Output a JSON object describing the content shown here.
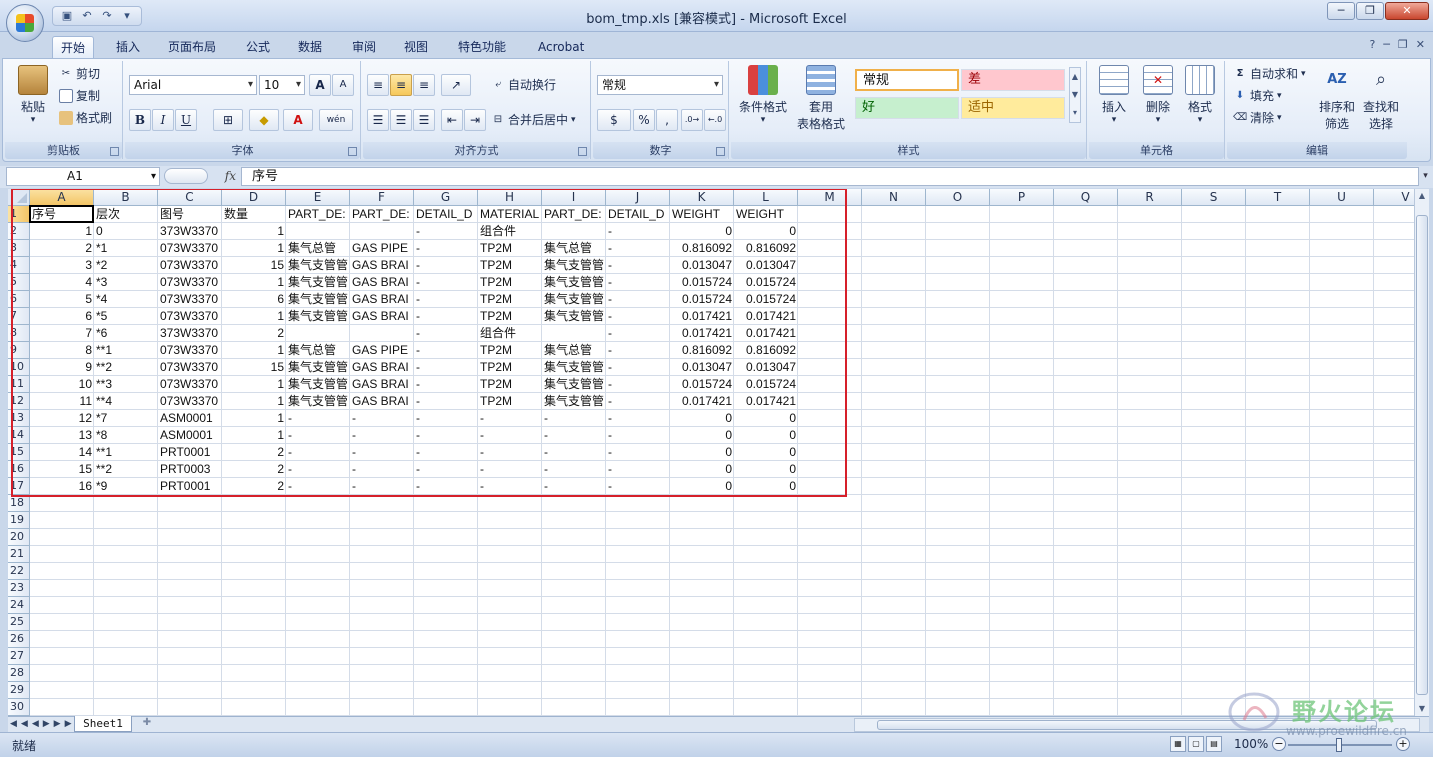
{
  "window": {
    "title": "bom_tmp.xls  [兼容模式] - Microsoft Excel"
  },
  "tabs": [
    "开始",
    "插入",
    "页面布局",
    "公式",
    "数据",
    "审阅",
    "视图",
    "特色功能",
    "Acrobat"
  ],
  "ribbon": {
    "clipboard": {
      "label": "剪贴板",
      "paste": "粘贴",
      "cut": "剪切",
      "copy": "复制",
      "painter": "格式刷"
    },
    "font": {
      "label": "字体",
      "name": "Arial",
      "size": "10",
      "bold": "B",
      "italic": "I",
      "underline": "U",
      "phonetic": "wén"
    },
    "alignment": {
      "label": "对齐方式",
      "wrap": "自动换行",
      "merge": "合并后居中"
    },
    "number": {
      "label": "数字",
      "format": "常规",
      "percent": "%",
      "comma": ","
    },
    "styles": {
      "label": "样式",
      "conditional": "条件格式",
      "table": "套用",
      "table2": "表格格式",
      "normal": "常规",
      "bad": "差",
      "good": "好",
      "neutral": "适中"
    },
    "cells": {
      "label": "单元格",
      "insert": "插入",
      "delete": "删除",
      "format": "格式"
    },
    "editing": {
      "label": "编辑",
      "autosum": "自动求和",
      "fill": "填充",
      "clear": "清除",
      "sort1": "排序和",
      "sort2": "筛选",
      "find1": "查找和",
      "find2": "选择"
    }
  },
  "formula_bar": {
    "name_box": "A1",
    "fx": "fx",
    "content": "序号"
  },
  "columns": [
    "A",
    "B",
    "C",
    "D",
    "E",
    "F",
    "G",
    "H",
    "I",
    "J",
    "K",
    "L",
    "M",
    "N",
    "O",
    "P",
    "Q",
    "R",
    "S",
    "T",
    "U",
    "V"
  ],
  "row_numbers": [
    "1",
    "2",
    "3",
    "4",
    "5",
    "6",
    "7",
    "8",
    "9",
    "10",
    "11",
    "12",
    "13",
    "14",
    "15",
    "16",
    "17",
    "18",
    "19",
    "20",
    "21",
    "22",
    "23",
    "24",
    "25",
    "26",
    "27",
    "28",
    "29",
    "30"
  ],
  "rows": [
    [
      "序号",
      "层次",
      "图号",
      "数量",
      "PART_DE:",
      "PART_DE:",
      "DETAIL_D",
      "MATERIAL",
      "PART_DE:",
      "DETAIL_D",
      "WEIGHT",
      "WEIGHT"
    ],
    [
      "1",
      "0",
      "373W3370",
      "1",
      "",
      "",
      "-",
      "组合件",
      "",
      "-",
      "0",
      "0"
    ],
    [
      "2",
      "*1",
      "073W3370",
      "1",
      "集气总管",
      "GAS PIPE",
      "-",
      "TP2M",
      "集气总管",
      "-",
      "0.816092",
      "0.816092"
    ],
    [
      "3",
      "*2",
      "073W3370",
      "15",
      "集气支管管",
      "GAS BRAI",
      "-",
      "TP2M",
      "集气支管管",
      "-",
      "0.013047",
      "0.013047"
    ],
    [
      "4",
      "*3",
      "073W3370",
      "1",
      "集气支管管",
      "GAS BRAI",
      "-",
      "TP2M",
      "集气支管管",
      "-",
      "0.015724",
      "0.015724"
    ],
    [
      "5",
      "*4",
      "073W3370",
      "6",
      "集气支管管",
      "GAS BRAI",
      "-",
      "TP2M",
      "集气支管管",
      "-",
      "0.015724",
      "0.015724"
    ],
    [
      "6",
      "*5",
      "073W3370",
      "1",
      "集气支管管",
      "GAS BRAI",
      "-",
      "TP2M",
      "集气支管管",
      "-",
      "0.017421",
      "0.017421"
    ],
    [
      "7",
      "*6",
      "373W3370",
      "2",
      "",
      "",
      "-",
      "组合件",
      "",
      "-",
      "0.017421",
      "0.017421"
    ],
    [
      "8",
      "**1",
      "073W3370",
      "1",
      "集气总管",
      "GAS PIPE",
      "-",
      "TP2M",
      "集气总管",
      "-",
      "0.816092",
      "0.816092"
    ],
    [
      "9",
      "**2",
      "073W3370",
      "15",
      "集气支管管",
      "GAS BRAI",
      "-",
      "TP2M",
      "集气支管管",
      "-",
      "0.013047",
      "0.013047"
    ],
    [
      "10",
      "**3",
      "073W3370",
      "1",
      "集气支管管",
      "GAS BRAI",
      "-",
      "TP2M",
      "集气支管管",
      "-",
      "0.015724",
      "0.015724"
    ],
    [
      "11",
      "**4",
      "073W3370",
      "1",
      "集气支管管",
      "GAS BRAI",
      "-",
      "TP2M",
      "集气支管管",
      "-",
      "0.017421",
      "0.017421"
    ],
    [
      "12",
      "*7",
      "ASM0001",
      "1",
      "-",
      "-",
      "-",
      "-",
      "-",
      "-",
      "0",
      "0"
    ],
    [
      "13",
      "*8",
      "ASM0001",
      "1",
      "-",
      "-",
      "-",
      "-",
      "-",
      "-",
      "0",
      "0"
    ],
    [
      "14",
      "**1",
      "PRT0001",
      "2",
      "-",
      "-",
      "-",
      "-",
      "-",
      "-",
      "0",
      "0"
    ],
    [
      "15",
      "**2",
      "PRT0003",
      "2",
      "-",
      "-",
      "-",
      "-",
      "-",
      "-",
      "0",
      "0"
    ],
    [
      "16",
      "*9",
      "PRT0001",
      "2",
      "-",
      "-",
      "-",
      "-",
      "-",
      "-",
      "0",
      "0"
    ]
  ],
  "sheet_tabs": [
    "Sheet1"
  ],
  "status": {
    "text": "就绪",
    "zoom": "100%"
  },
  "watermark": {
    "text": "野火论坛",
    "url": "www.proewildfire.cn"
  },
  "colors": {
    "annotation": "#d6202a",
    "bad_bg": "#ffc7ce",
    "good_bg": "#c6efce",
    "neutral_bg": "#ffeb9c"
  }
}
